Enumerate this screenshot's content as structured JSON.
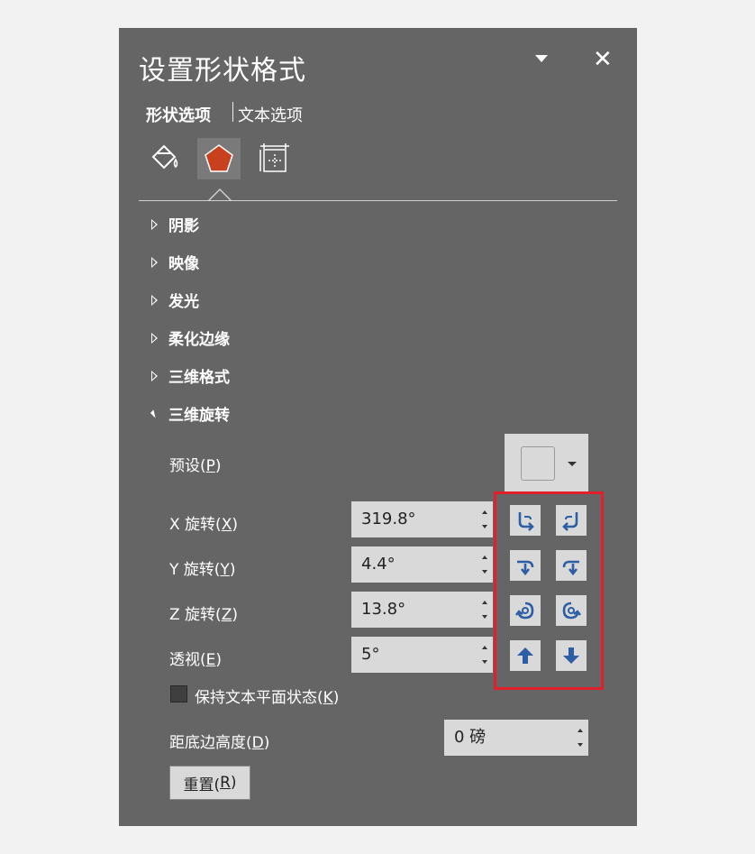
{
  "panel": {
    "title": "设置形状格式",
    "close_label": "✕",
    "tabs": [
      {
        "label": "形状选项",
        "active": true
      },
      {
        "label": "文本选项",
        "active": false
      }
    ],
    "icon_tabs": [
      "fill-line-icon",
      "effects-pentagon-icon",
      "size-properties-icon"
    ],
    "sections": [
      {
        "label": "阴影",
        "expanded": false
      },
      {
        "label": "映像",
        "expanded": false
      },
      {
        "label": "发光",
        "expanded": false
      },
      {
        "label": "柔化边缘",
        "expanded": false
      },
      {
        "label": "三维格式",
        "expanded": false
      },
      {
        "label": "三维旋转",
        "expanded": true
      }
    ],
    "rotation": {
      "preset_label": "预设(",
      "preset_key": "P",
      "label_close": ")",
      "x": {
        "label_prefix": "X 旋转(",
        "key": "X",
        "value": "319.8°"
      },
      "y": {
        "label_prefix": "Y 旋转(",
        "key": "Y",
        "value": "4.4°"
      },
      "z": {
        "label_prefix": "Z 旋转(",
        "key": "Z",
        "value": "13.8°"
      },
      "persp": {
        "label_prefix": "透视(",
        "key": "E",
        "value": "5°"
      },
      "keep_flat": {
        "label_prefix": "保持文本平面状态(",
        "key": "K",
        "checked": false
      },
      "distance": {
        "label_prefix": "距底边高度(",
        "key": "D",
        "value": "0 磅"
      },
      "reset": {
        "label_prefix": "重置(",
        "key": "R"
      }
    },
    "colors": {
      "panel_bg": "#656565",
      "highlight": "#e0202a",
      "icon_blue": "#2b5ea5",
      "effects_orange": "#c8401e"
    }
  }
}
